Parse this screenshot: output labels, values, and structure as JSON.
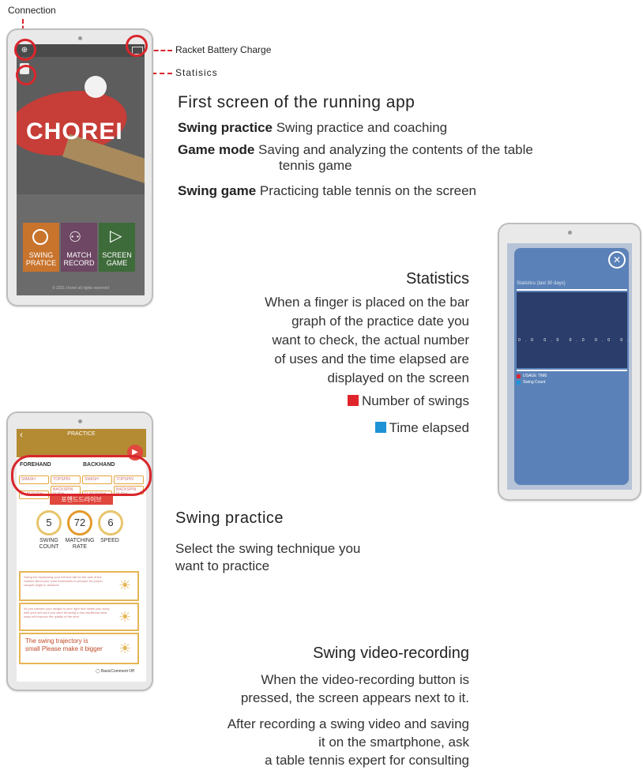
{
  "callouts": {
    "connection": "Connection",
    "battery": "Racket Battery Charge",
    "statistics": "Statisics"
  },
  "first_screen": {
    "title": "First screen of the running app",
    "rows": [
      {
        "term": "Swing practice",
        "desc": "Swing practice and coaching"
      },
      {
        "term": "Game mode",
        "desc": "Saving and analyzing the contents of the table",
        "desc2": "tennis game"
      },
      {
        "term": "Swing game",
        "desc": "Practicing table tennis on the screen"
      }
    ]
  },
  "home_tablet": {
    "logo": "CHOREI",
    "tiles": [
      {
        "label": "SWING PRATICE",
        "color": "#c8742d"
      },
      {
        "label": "MATCH RECORD",
        "color": "#6d4763"
      },
      {
        "label": "SCREEN GAME",
        "color": "#3e6b3a"
      }
    ],
    "footer": "© 2021 chorei all rights reserved"
  },
  "statistics": {
    "title": "Statistics",
    "lines": [
      "When a finger is placed on the bar",
      "graph of the practice date you",
      "want to check, the actual number",
      "of uses and the time elapsed are",
      "displayed on the screen"
    ],
    "legend": [
      {
        "label": "Number of swings",
        "color": "#e0242b"
      },
      {
        "label": "Time elapsed",
        "color": "#1f93d6"
      }
    ]
  },
  "stats_tablet": {
    "close_icon": "close-icon",
    "chart_title": "Statistics (last 30 days)",
    "legend": [
      "USAGE TIME",
      "Swing Count"
    ]
  },
  "practice_tablet": {
    "header": "PRACTICE",
    "forehand": "FOREHAND",
    "backhand": "BACKHAND",
    "pills": [
      "SMASH",
      "TOPSPIN",
      "SMASH",
      "TOPSPIN",
      "FLAT PUSH",
      "BACKSPIN PUSH",
      "FLAT PUSH",
      "BACKSPIN PUSH"
    ],
    "mode_button": "포핸드드라이브",
    "stats": [
      {
        "value": "5",
        "label": "SWING COUNT"
      },
      {
        "value": "72",
        "label": "MATCHING RATE"
      },
      {
        "value": "6",
        "label": "SPEED"
      }
    ],
    "tips": [
      "Swing the backswing your left foot will be the axis of the rotation Bend your wrist backwards to prepare for proper racquet angle in advance",
      "As you transfer your weight to your right foot rotate your body with your arm as if you were throwing a disc Additional wrist snap will improve the quality of the shot",
      "The swing trajectory is small Please make it bigger"
    ],
    "checkbox_label": "BasicComment Off"
  },
  "swing_practice": {
    "title": "Swing practice",
    "lines": [
      "Select the swing technique you",
      "want to practice"
    ]
  },
  "video": {
    "title": "Swing video-recording",
    "p1": [
      "When the video-recording button is",
      "pressed, the screen appears next to it."
    ],
    "p2": [
      "After recording a swing video and saving",
      "it on the smartphone, ask",
      "a table tennis expert for consulting"
    ]
  }
}
